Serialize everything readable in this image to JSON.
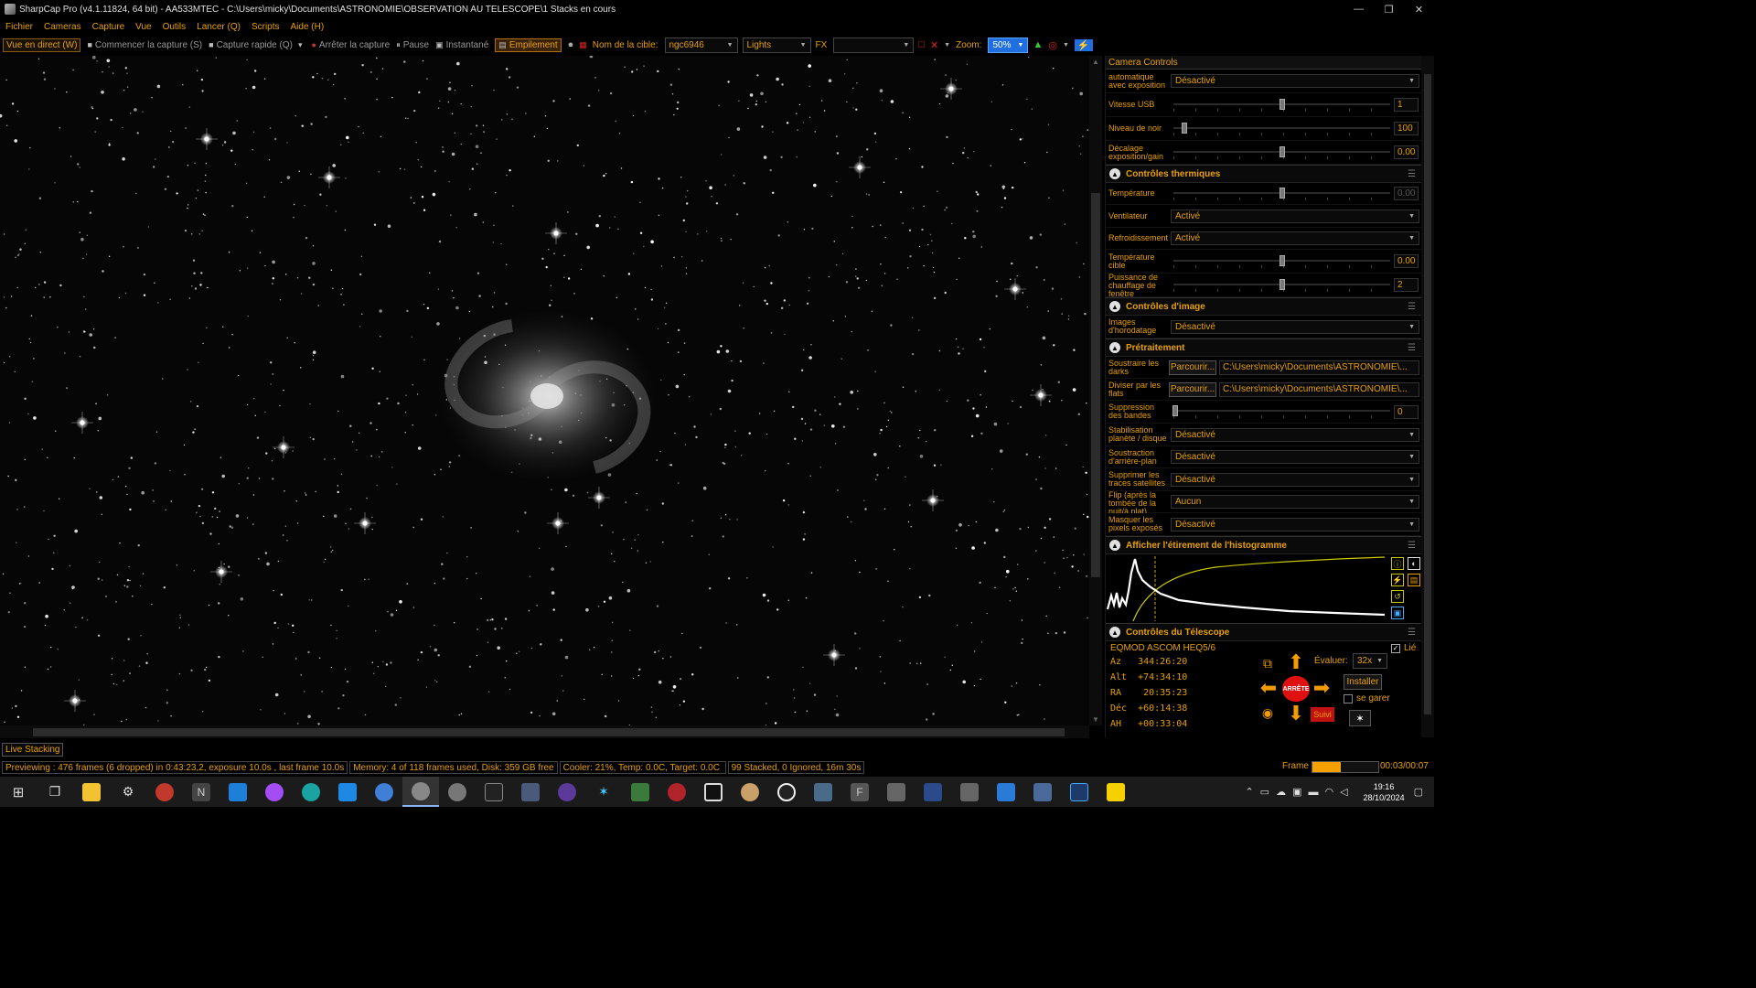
{
  "window": {
    "title": "SharpCap Pro (v4.1.11824, 64 bit) - AA533MTEC - C:\\Users\\micky\\Documents\\ASTRONOMIE\\OBSERVATION AU TELESCOPE\\1 Stacks en cours",
    "minimize": "—",
    "maximize": "❐",
    "close": "✕"
  },
  "menu": [
    "Fichier",
    "Cameras",
    "Capture",
    "Vue",
    "Outils",
    "Lancer (Q)",
    "Scripts",
    "Aide (H)"
  ],
  "toolbar": {
    "live_view": "Vue en direct (W)",
    "start_capture": "Commencer la capture (S)",
    "quick_capture": "Capture rapide (Q)",
    "stop_capture": "Arrêter la capture",
    "pause": "Pause",
    "snapshot": "Instantané",
    "stacking": "Empilement",
    "target_label": "Nom de la cible:",
    "target_value": "ngc6946",
    "frame_type": "Lights",
    "fx_label": "FX",
    "fx_value": "",
    "zoom_label": "Zoom:",
    "zoom_value": "50%"
  },
  "panel": {
    "camera_controls": "Camera Controls",
    "camera_rows": [
      {
        "label": "automatique avec exposition",
        "type": "dropdown",
        "value": "Désactivé"
      },
      {
        "label": "Vitesse USB",
        "type": "slider",
        "value": "1",
        "level": 0.5
      },
      {
        "label": "Niveau de noir",
        "type": "slider",
        "value": "100",
        "level": 0.05
      },
      {
        "label": "Décalage exposition/gain",
        "type": "slider",
        "value": "0.00",
        "level": 0.5
      }
    ],
    "thermal": {
      "title": "Contrôles thermiques",
      "temperature_label": "Température",
      "temperature_value": "0.00",
      "fan_label": "Ventilateur",
      "fan_value": "Activé",
      "cooling_label": "Refroidissement",
      "cooling_value": "Activé",
      "target_temp_label": "Température cible",
      "target_temp_value": "0.00",
      "heater_label": "Puissance de chauffage de fenêtre",
      "heater_value": "2"
    },
    "image": {
      "title": "Contrôles d'image",
      "timestamp_label": "Images d'horodatage",
      "timestamp_value": "Désactivé"
    },
    "preprocessing": {
      "title": "Prétraitement",
      "browse": "Parcourir...",
      "darks_label": "Soustraire les darks",
      "darks_path": "C:\\Users\\micky\\Documents\\ASTRONOMIE\\...",
      "flats_label": "Diviser par les flats",
      "flats_path": "C:\\Users\\micky\\Documents\\ASTRONOMIE\\...",
      "banding_label": "Suppression des bandes",
      "banding_value": "0",
      "stab_label": "Stabilisation planète / disque",
      "stab_value": "Désactivé",
      "bg_label": "Soustraction d'arrière-plan",
      "bg_value": "Désactivé",
      "sat_label": "Supprimer les traces satellites",
      "sat_value": "Désactivé",
      "flip_label": "Flip (après la tombée de la nuit/à plat)",
      "flip_value": "Aucun",
      "mask_label": "Masquer les pixels exposés",
      "mask_value": "Désactivé"
    },
    "histogram": {
      "title": "Afficher l'étirement de l'histogramme"
    },
    "telescope": {
      "title": "Contrôles du Télescope",
      "mount": "EQMOD ASCOM HEQ5/6",
      "linked_label": "Lié",
      "az": "Az   344:26:20",
      "alt": "Alt  +74:34:10",
      "ra": "RA    20:35:23",
      "dec": "Déc  +60:14:38",
      "ah": "AH   +00:33:04",
      "stop": "ARRÊTE",
      "rate_label": "Évaluer:",
      "rate_value": "32x",
      "install": "Installer",
      "park": "se garer",
      "track": "Suivi"
    }
  },
  "status": {
    "live_stacking": "Live Stacking",
    "preview": "Previewing : 476 frames (6 dropped) in 0:43:23,2, exposure 10.0s , last frame 10.0s",
    "memory": "Memory: 4 of 118 frames used, Disk: 359 GB free",
    "cooler": "Cooler: 21%, Temp: 0.0C, Target: 0.0C",
    "stacked": "99 Stacked, 0 Ignored, 16m 30s",
    "frame_label": "Frame :",
    "frame_value": "00:03/00:07",
    "frame_progress": 0.43
  },
  "taskbar": {
    "time": "19:16",
    "date": "28/10/2024"
  },
  "colors": {
    "accent": "#e6a000",
    "zoom_highlight": "#1f6fe0",
    "stop_red": "#e01010"
  }
}
